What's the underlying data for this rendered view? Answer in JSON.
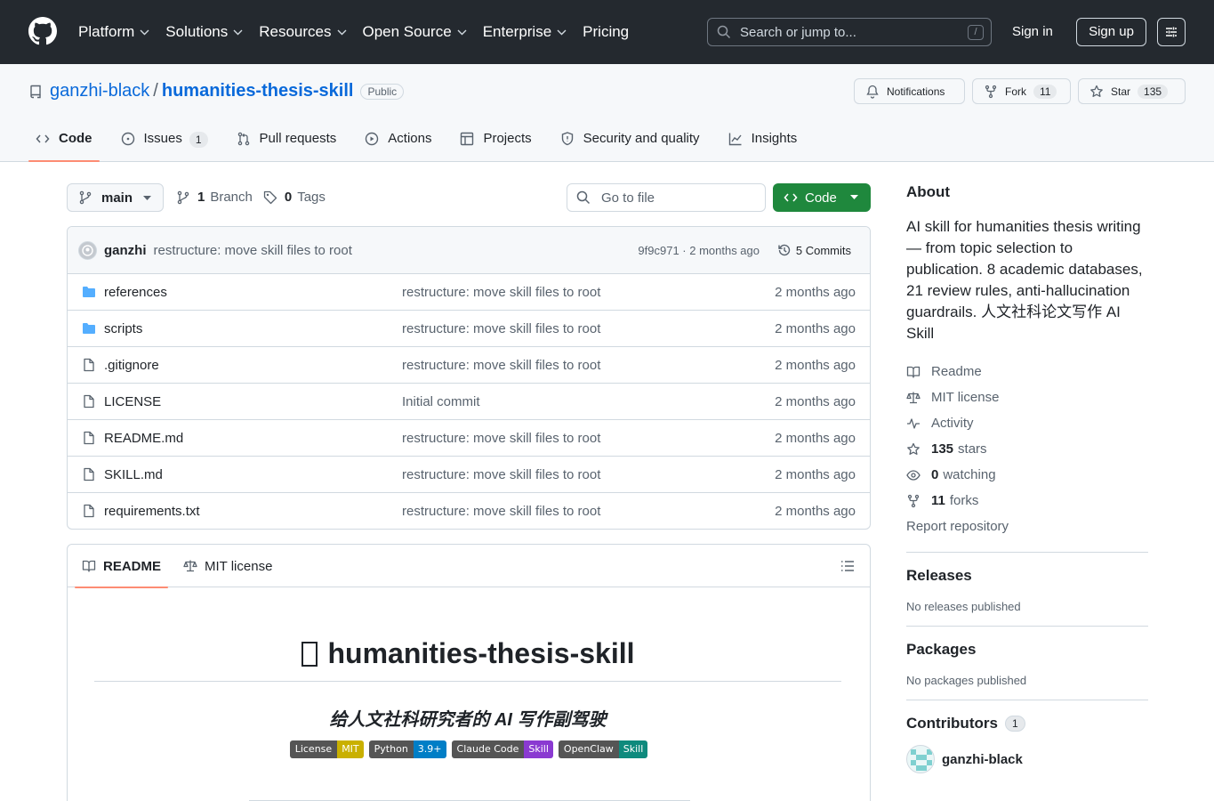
{
  "topnav": {
    "items": [
      {
        "label": "Platform",
        "dropdown": true
      },
      {
        "label": "Solutions",
        "dropdown": true
      },
      {
        "label": "Resources",
        "dropdown": true
      },
      {
        "label": "Open Source",
        "dropdown": true
      },
      {
        "label": "Enterprise",
        "dropdown": true
      },
      {
        "label": "Pricing",
        "dropdown": false
      }
    ],
    "search_placeholder": "Search or jump to...",
    "search_shortcut": "/",
    "signin_label": "Sign in",
    "signup_label": "Sign up"
  },
  "repo": {
    "owner": "ganzhi-black",
    "separator": "/",
    "name": "humanities-thesis-skill",
    "visibility": "Public",
    "notifications_label": "Notifications",
    "fork_label": "Fork",
    "fork_count": "11",
    "star_label": "Star",
    "star_count": "135"
  },
  "tabs": [
    {
      "label": "Code",
      "icon": "code-icon",
      "active": true
    },
    {
      "label": "Issues",
      "icon": "issue-icon",
      "count": "1"
    },
    {
      "label": "Pull requests",
      "icon": "pull-request-icon"
    },
    {
      "label": "Actions",
      "icon": "play-icon"
    },
    {
      "label": "Projects",
      "icon": "table-icon"
    },
    {
      "label": "Security and quality",
      "icon": "shield-icon"
    },
    {
      "label": "Insights",
      "icon": "graph-icon"
    }
  ],
  "branchbar": {
    "branch": "main",
    "branch_count": "1",
    "branch_label": "Branch",
    "tag_count": "0",
    "tag_label": "Tags",
    "gofile_placeholder": "Go to file",
    "code_label": "Code"
  },
  "latest_commit": {
    "author": "ganzhi",
    "message": "restructure: move skill files to root",
    "meta": "9f9c971 · 2 months ago",
    "commits_label": "5 Commits"
  },
  "files": [
    {
      "name": "references",
      "type": "dir",
      "message": "restructure: move skill files to root",
      "date": "2 months ago"
    },
    {
      "name": "scripts",
      "type": "dir",
      "message": "restructure: move skill files to root",
      "date": "2 months ago"
    },
    {
      "name": ".gitignore",
      "type": "file",
      "message": "restructure: move skill files to root",
      "date": "2 months ago"
    },
    {
      "name": "LICENSE",
      "type": "file",
      "message": "Initial commit",
      "date": "2 months ago"
    },
    {
      "name": "README.md",
      "type": "file",
      "message": "restructure: move skill files to root",
      "date": "2 months ago"
    },
    {
      "name": "SKILL.md",
      "type": "file",
      "message": "restructure: move skill files to root",
      "date": "2 months ago"
    },
    {
      "name": "requirements.txt",
      "type": "file",
      "message": "restructure: move skill files to root",
      "date": "2 months ago"
    }
  ],
  "readme": {
    "tab_readme": "README",
    "tab_license": "MIT license",
    "title": "humanities-thesis-skill",
    "subtitle": "给人文社科研究者的 AI 写作副驾驶",
    "badges": [
      {
        "left": "License",
        "right": "MIT",
        "color": "#c9b000"
      },
      {
        "left": "Python",
        "right": "3.9+",
        "color": "#007ec6"
      },
      {
        "left": "Claude Code",
        "right": "Skill",
        "color": "#8a3ad1"
      },
      {
        "left": "OpenClaw",
        "right": "Skill",
        "color": "#0e8a7d"
      }
    ]
  },
  "about": {
    "heading": "About",
    "description": "AI skill for humanities thesis writing — from topic selection to publication. 8 academic databases, 21 review rules, anti-hallucination guardrails. 人文社科论文写作 AI Skill",
    "links": [
      {
        "icon": "book-icon",
        "strong": "",
        "label": "Readme"
      },
      {
        "icon": "law-icon",
        "strong": "",
        "label": "MIT license"
      },
      {
        "icon": "pulse-icon",
        "strong": "",
        "label": "Activity"
      },
      {
        "icon": "star-icon",
        "strong": "135",
        "label": "stars"
      },
      {
        "icon": "eye-icon",
        "strong": "0",
        "label": "watching"
      },
      {
        "icon": "fork-icon",
        "strong": "11",
        "label": "forks"
      }
    ],
    "report": "Report repository"
  },
  "releases": {
    "heading": "Releases",
    "note": "No releases published"
  },
  "packages": {
    "heading": "Packages",
    "note": "No packages published"
  },
  "contributors": {
    "heading": "Contributors",
    "count": "1",
    "items": [
      {
        "name": "ganzhi-black"
      }
    ]
  }
}
